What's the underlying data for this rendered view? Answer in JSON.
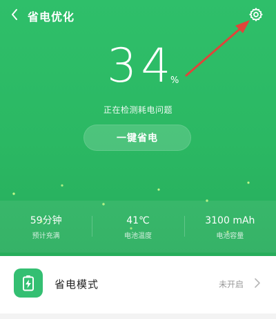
{
  "header": {
    "title": "省电优化",
    "back_icon": "chevron-left-icon",
    "settings_icon": "gear-icon"
  },
  "battery": {
    "level_value": "34",
    "level_unit": "%",
    "status_text": "正在检测耗电问题"
  },
  "actions": {
    "one_tap_save_label": "一键省电"
  },
  "stats": [
    {
      "value": "59分钟",
      "label": "预计充满"
    },
    {
      "value": "41℃",
      "label": "电池温度"
    },
    {
      "value": "3100 mAh",
      "label": "电池容量"
    }
  ],
  "list": {
    "power_saving_mode": {
      "label": "省电模式",
      "value": "未开启",
      "icon": "battery-charging-icon"
    }
  },
  "colors": {
    "brand_green": "#2bb863",
    "icon_green": "#34bf72",
    "annotation_arrow": "#e0443a"
  }
}
